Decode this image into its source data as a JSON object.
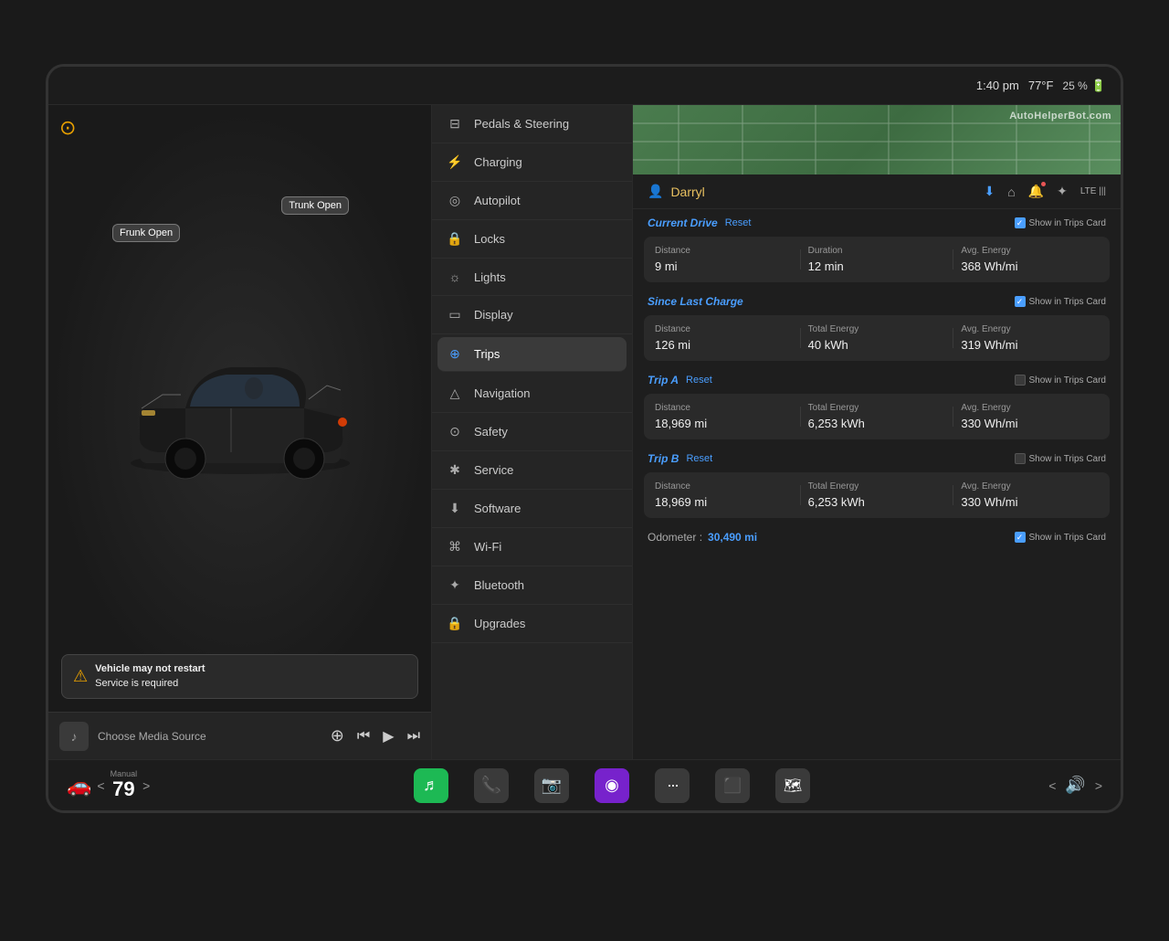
{
  "topbar": {
    "time": "1:40 pm",
    "temp": "77°F",
    "battery": "25 %"
  },
  "car": {
    "frunk_label": "Frunk Open",
    "trunk_label": "Trunk Open",
    "warning_title": "Vehicle may not restart",
    "warning_sub": "Service is required"
  },
  "media": {
    "placeholder": "Choose Media Source",
    "music_symbol": "♪"
  },
  "menu": {
    "items": [
      {
        "id": "pedals",
        "label": "Pedals & Steering",
        "icon": "⊟"
      },
      {
        "id": "charging",
        "label": "Charging",
        "icon": "⚡"
      },
      {
        "id": "autopilot",
        "label": "Autopilot",
        "icon": "◎"
      },
      {
        "id": "locks",
        "label": "Locks",
        "icon": "🔒"
      },
      {
        "id": "lights",
        "label": "Lights",
        "icon": "☼"
      },
      {
        "id": "display",
        "label": "Display",
        "icon": "▭"
      },
      {
        "id": "trips",
        "label": "Trips",
        "icon": "⊕",
        "active": true
      },
      {
        "id": "navigation",
        "label": "Navigation",
        "icon": "△"
      },
      {
        "id": "safety",
        "label": "Safety",
        "icon": "⊙"
      },
      {
        "id": "service",
        "label": "Service",
        "icon": "✱"
      },
      {
        "id": "software",
        "label": "Software",
        "icon": "⬇"
      },
      {
        "id": "wifi",
        "label": "Wi-Fi",
        "icon": "⌘"
      },
      {
        "id": "bluetooth",
        "label": "Bluetooth",
        "icon": "✦"
      },
      {
        "id": "upgrades",
        "label": "Upgrades",
        "icon": "🔒"
      }
    ]
  },
  "trips": {
    "user": "Darryl",
    "current_drive": {
      "title": "Current Drive",
      "reset_label": "Reset",
      "show_trips_label": "Show in Trips Card",
      "distance_label": "Distance",
      "distance_value": "9 mi",
      "duration_label": "Duration",
      "duration_value": "12 min",
      "energy_label": "Avg. Energy",
      "energy_value": "368 Wh/mi"
    },
    "since_last_charge": {
      "title": "Since Last Charge",
      "show_trips_label": "Show in Trips Card",
      "distance_label": "Distance",
      "distance_value": "126 mi",
      "total_energy_label": "Total Energy",
      "total_energy_value": "40 kWh",
      "energy_label": "Avg. Energy",
      "energy_value": "319 Wh/mi"
    },
    "trip_a": {
      "title": "Trip A",
      "reset_label": "Reset",
      "show_trips_label": "Show in Trips Card",
      "distance_label": "Distance",
      "distance_value": "18,969 mi",
      "total_energy_label": "Total Energy",
      "total_energy_value": "6,253 kWh",
      "energy_label": "Avg. Energy",
      "energy_value": "330 Wh/mi"
    },
    "trip_b": {
      "title": "Trip B",
      "reset_label": "Reset",
      "show_trips_label": "Show in Trips Card",
      "distance_label": "Distance",
      "distance_value": "18,969 mi",
      "total_energy_label": "Total Energy",
      "total_energy_value": "6,253 kWh",
      "energy_label": "Avg. Energy",
      "energy_value": "330 Wh/mi"
    },
    "odometer_label": "Odometer :",
    "odometer_value": "30,490 mi",
    "odometer_show_label": "Show in Trips Card"
  },
  "bottombar": {
    "car_icon": "🚗",
    "temp_label": "Manual",
    "temp_value": "79",
    "temp_unit": "°",
    "apps": [
      {
        "id": "spotify",
        "symbol": "🎵",
        "color": "#1DB954"
      },
      {
        "id": "phone",
        "symbol": "📞",
        "color": "#555"
      },
      {
        "id": "camera",
        "symbol": "📷",
        "color": "#555"
      },
      {
        "id": "radio",
        "symbol": "📻",
        "color": "#8855ff"
      },
      {
        "id": "dots",
        "symbol": "⋯",
        "color": "#555"
      },
      {
        "id": "app2",
        "symbol": "⬛",
        "color": "#555"
      },
      {
        "id": "map2",
        "symbol": "🗺",
        "color": "#555"
      }
    ],
    "volume_label": "🔊",
    "nav_left": "<",
    "nav_right": ">"
  },
  "watermark": "AutoHelperBot.com"
}
